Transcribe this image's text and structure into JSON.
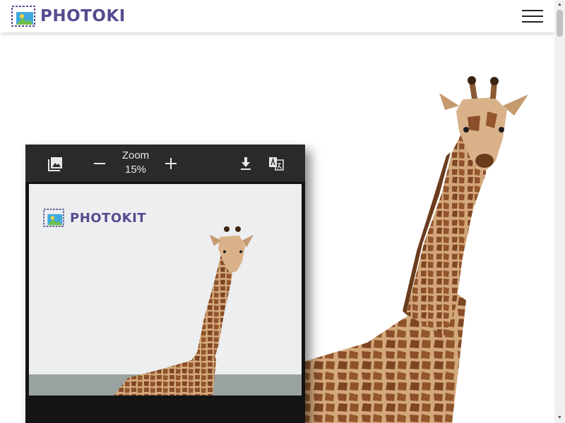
{
  "header": {
    "brand_name": "PHOTOKIT",
    "brand_visible": "PHOTOKI",
    "logo_icon": "image-frame-icon",
    "menu_icon": "hamburger-icon"
  },
  "editor_preview": {
    "toolbar": {
      "image_icon": "gallery-icon",
      "zoom_out_icon": "minus-icon",
      "zoom_label": "Zoom",
      "zoom_value": "15%",
      "zoom_in_icon": "plus-icon",
      "download_icon": "download-icon",
      "translate_icon": "translate-icon"
    },
    "document": {
      "brand_name": "PHOTOKIT"
    }
  },
  "colors": {
    "brand": "#554c8f",
    "toolbar": "#2a2a2a",
    "panel": "#141414",
    "giraffe_base": "#c89a6a",
    "giraffe_spots": "#8a4f2a"
  }
}
